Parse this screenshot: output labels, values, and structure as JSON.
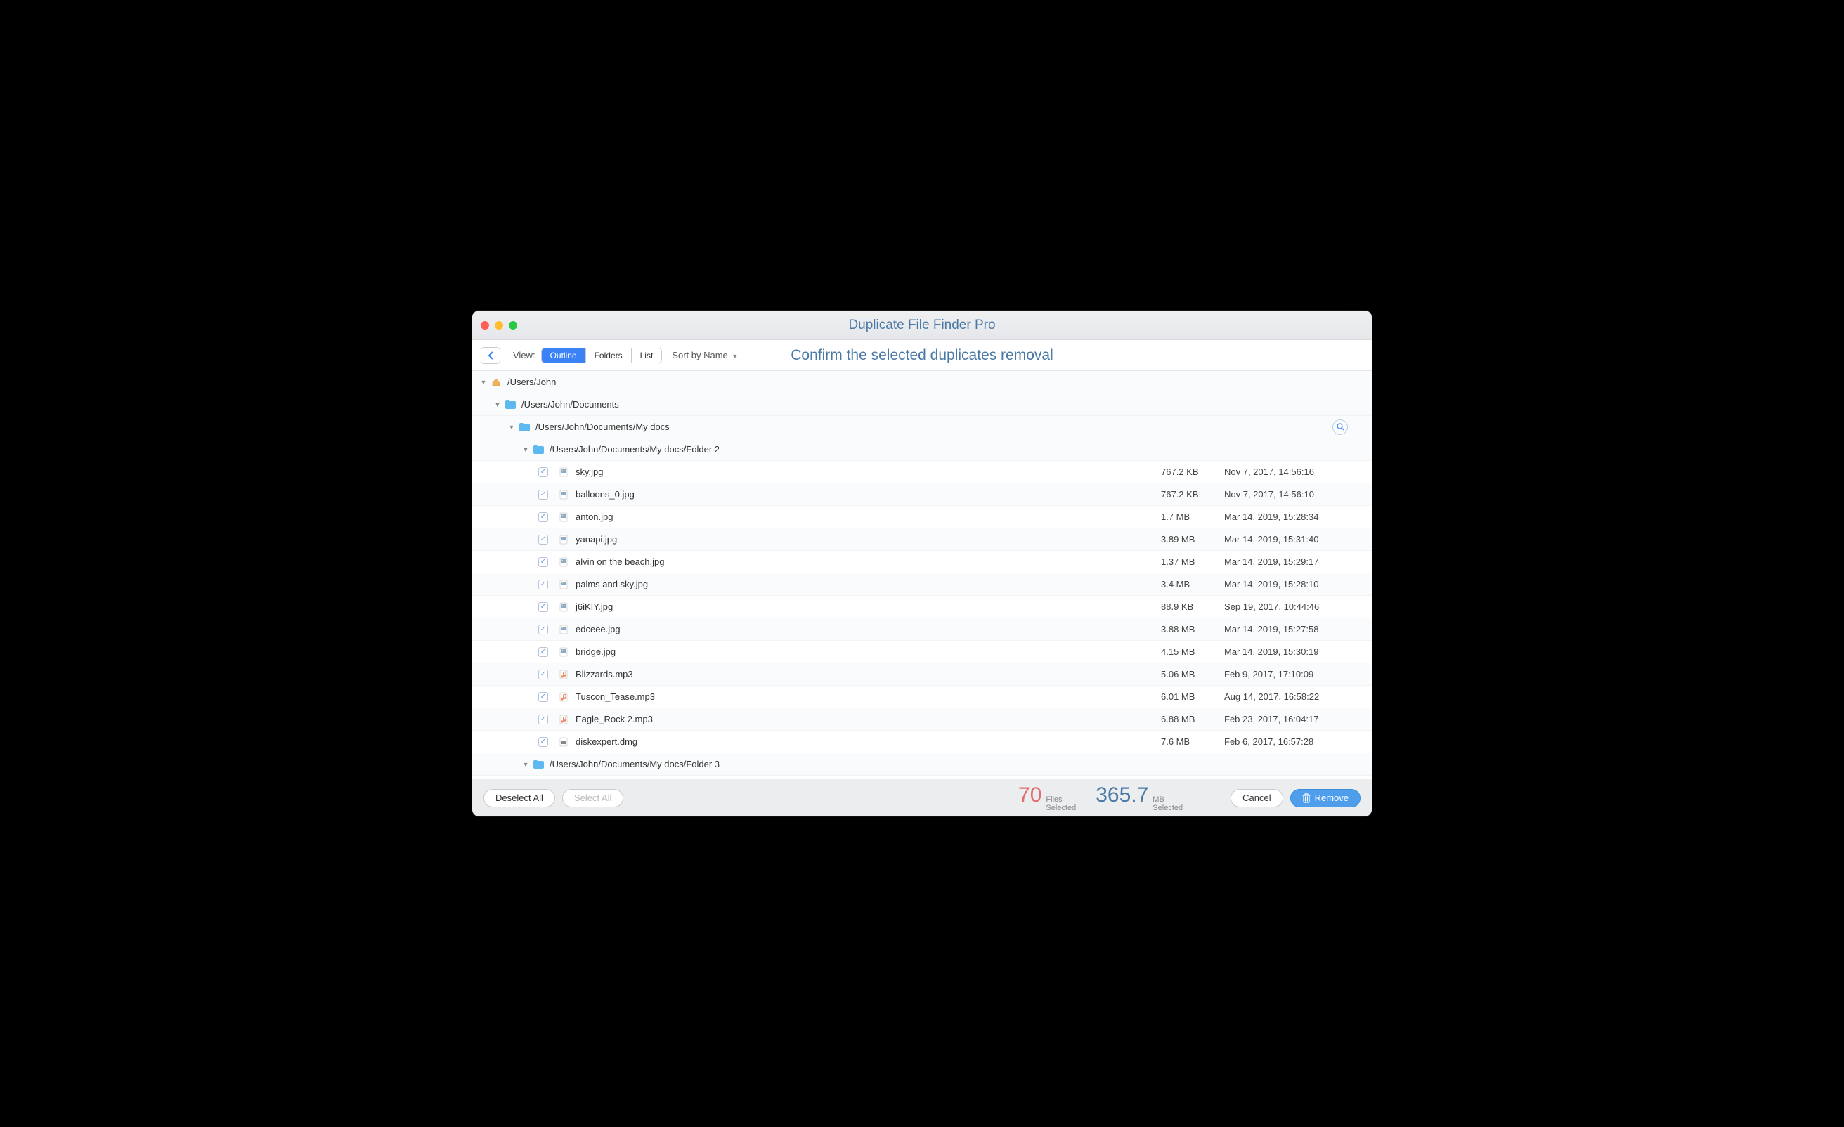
{
  "window": {
    "title": "Duplicate File Finder Pro"
  },
  "toolbar": {
    "view_label": "View:",
    "segments": [
      "Outline",
      "Folders",
      "List"
    ],
    "active_segment_index": 0,
    "sort_label": "Sort by Name",
    "subtitle": "Confirm the selected duplicates removal"
  },
  "tree": {
    "root": {
      "path": "/Users/John",
      "icon": "home"
    },
    "l1": {
      "path": "/Users/John/Documents"
    },
    "l2": {
      "path": "/Users/John/Documents/My docs",
      "has_search": true
    },
    "l3a": {
      "path": "/Users/John/Documents/My docs/Folder 2"
    },
    "l3b": {
      "path": "/Users/John/Documents/My docs/Folder 3"
    }
  },
  "files": [
    {
      "name": "sky.jpg",
      "icon": "jpg",
      "size": "767.2 KB",
      "date": "Nov 7, 2017, 14:56:16"
    },
    {
      "name": "balloons_0.jpg",
      "icon": "jpg",
      "size": "767.2 KB",
      "date": "Nov 7, 2017, 14:56:10"
    },
    {
      "name": "anton.jpg",
      "icon": "jpg",
      "size": "1.7 MB",
      "date": "Mar 14, 2019, 15:28:34"
    },
    {
      "name": "yanapi.jpg",
      "icon": "jpg",
      "size": "3.89 MB",
      "date": "Mar 14, 2019, 15:31:40"
    },
    {
      "name": "alvin on the beach.jpg",
      "icon": "jpg",
      "size": "1.37 MB",
      "date": "Mar 14, 2019, 15:29:17"
    },
    {
      "name": "palms and sky.jpg",
      "icon": "jpg",
      "size": "3.4 MB",
      "date": "Mar 14, 2019, 15:28:10"
    },
    {
      "name": "j6iKIY.jpg",
      "icon": "jpg",
      "size": "88.9 KB",
      "date": "Sep 19, 2017, 10:44:46"
    },
    {
      "name": "edceee.jpg",
      "icon": "jpg",
      "size": "3.88 MB",
      "date": "Mar 14, 2019, 15:27:58"
    },
    {
      "name": "bridge.jpg",
      "icon": "jpg",
      "size": "4.15 MB",
      "date": "Mar 14, 2019, 15:30:19"
    },
    {
      "name": "Blizzards.mp3",
      "icon": "mp3",
      "size": "5.06 MB",
      "date": "Feb 9, 2017, 17:10:09"
    },
    {
      "name": "Tuscon_Tease.mp3",
      "icon": "mp3",
      "size": "6.01 MB",
      "date": "Aug 14, 2017, 16:58:22"
    },
    {
      "name": "Eagle_Rock 2.mp3",
      "icon": "mp3",
      "size": "6.88 MB",
      "date": "Feb 23, 2017, 16:04:17"
    },
    {
      "name": "diskexpert.dmg",
      "icon": "dmg",
      "size": "7.6 MB",
      "date": "Feb 6, 2017, 16:57:28"
    }
  ],
  "footer": {
    "deselect_all": "Deselect All",
    "select_all": "Select All",
    "files_count": "70",
    "files_unit": "Files",
    "files_selected": "Selected",
    "size_count": "365.7",
    "size_unit": "MB",
    "size_selected": "Selected",
    "cancel": "Cancel",
    "remove": "Remove"
  }
}
